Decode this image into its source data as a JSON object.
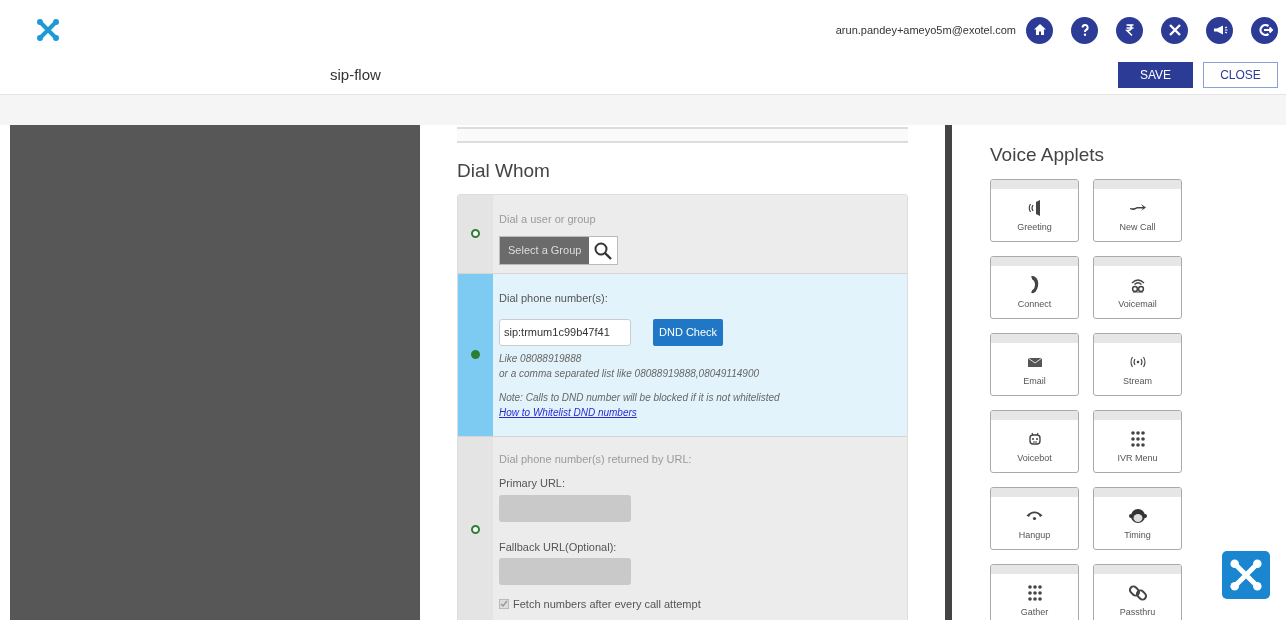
{
  "header": {
    "user_email": "arun.pandey+ameyo5m@exotel.com",
    "flow_name": "sip-flow",
    "buttons": [
      {
        "label": "SAVE",
        "kind": "primary"
      },
      {
        "label": "CLOSE",
        "kind": "secondary"
      }
    ]
  },
  "dial_whom": {
    "title": "Dial Whom",
    "options": [
      {
        "kind": "group",
        "selected": false,
        "heading": "Dial a user or group",
        "group_button": "Select a Group"
      },
      {
        "kind": "numbers",
        "selected": true,
        "heading": "Dial phone number(s):",
        "value": "sip:trmum1c99b47f41",
        "check_button": "DND Check",
        "hint_1": "Like 08088919888",
        "hint_2": "or a comma separated list like 08088919888,08049114900",
        "note": "Note: Calls to DND number will be blocked if it is not whitelisted",
        "link": "How to Whitelist DND numbers"
      },
      {
        "kind": "url",
        "selected": false,
        "heading": "Dial phone number(s) returned by URL:",
        "primary_label": "Primary URL:",
        "fallback_label": "Fallback URL(Optional):",
        "fetch_label": "Fetch numbers after every call attempt",
        "fetch_checked": true
      }
    ]
  },
  "applets": {
    "title": "Voice Applets",
    "items": [
      {
        "label": "Greeting"
      },
      {
        "label": "New Call"
      },
      {
        "label": "Connect"
      },
      {
        "label": "Voicemail"
      },
      {
        "label": "Email"
      },
      {
        "label": "Stream"
      },
      {
        "label": "Voicebot"
      },
      {
        "label": "IVR Menu"
      },
      {
        "label": "Hangup"
      },
      {
        "label": "Timing"
      },
      {
        "label": "Gather"
      },
      {
        "label": "Passthru"
      }
    ]
  }
}
